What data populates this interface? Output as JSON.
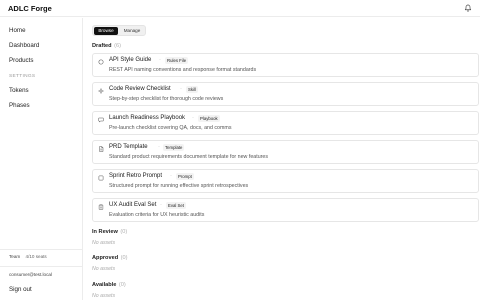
{
  "app": {
    "title": "ADLC Forge"
  },
  "sidebar": {
    "items": [
      {
        "label": "Home"
      },
      {
        "label": "Dashboard"
      },
      {
        "label": "Products"
      }
    ],
    "section_label": "SETTINGS",
    "settings_items": [
      {
        "label": "Tokens"
      },
      {
        "label": "Phases"
      }
    ],
    "footer": {
      "team_label": "Team",
      "seats": "4/10 seats",
      "email": "consumer@test.local",
      "sign_out": "Sign out"
    }
  },
  "main": {
    "tabs": [
      {
        "label": "Browse",
        "active": true
      },
      {
        "label": "Manage",
        "active": false
      }
    ],
    "sections": [
      {
        "title": "Drafted",
        "count": "(6)",
        "assets": [
          {
            "name": "API Style Guide",
            "type": "Rules File",
            "description": "REST API naming conventions and response format standards",
            "icon": "circle-icon"
          },
          {
            "name": "Code Review Checklist",
            "type": "Skill",
            "description": "Step-by-step checklist for thorough code reviews",
            "icon": "sparkle-icon"
          },
          {
            "name": "Launch Readiness Playbook",
            "type": "Playbook",
            "description": "Pre-launch checklist covering QA, docs, and comms",
            "icon": "chat-icon"
          },
          {
            "name": "PRD Template",
            "type": "Template",
            "description": "Standard product requirements document template for new features",
            "icon": "document-icon"
          },
          {
            "name": "Sprint Retro Prompt",
            "type": "Prompt",
            "description": "Structured prompt for running effective sprint retrospectives",
            "icon": "square-icon"
          },
          {
            "name": "UX Audit Eval Set",
            "type": "Eval Set",
            "description": "Evaluation criteria for UX heuristic audits",
            "icon": "clipboard-icon"
          }
        ]
      },
      {
        "title": "In Review",
        "count": "(0)",
        "empty_text": "No assets"
      },
      {
        "title": "Approved",
        "count": "(0)",
        "empty_text": "No assets"
      },
      {
        "title": "Available",
        "count": "(0)",
        "empty_text": "No assets"
      }
    ]
  }
}
